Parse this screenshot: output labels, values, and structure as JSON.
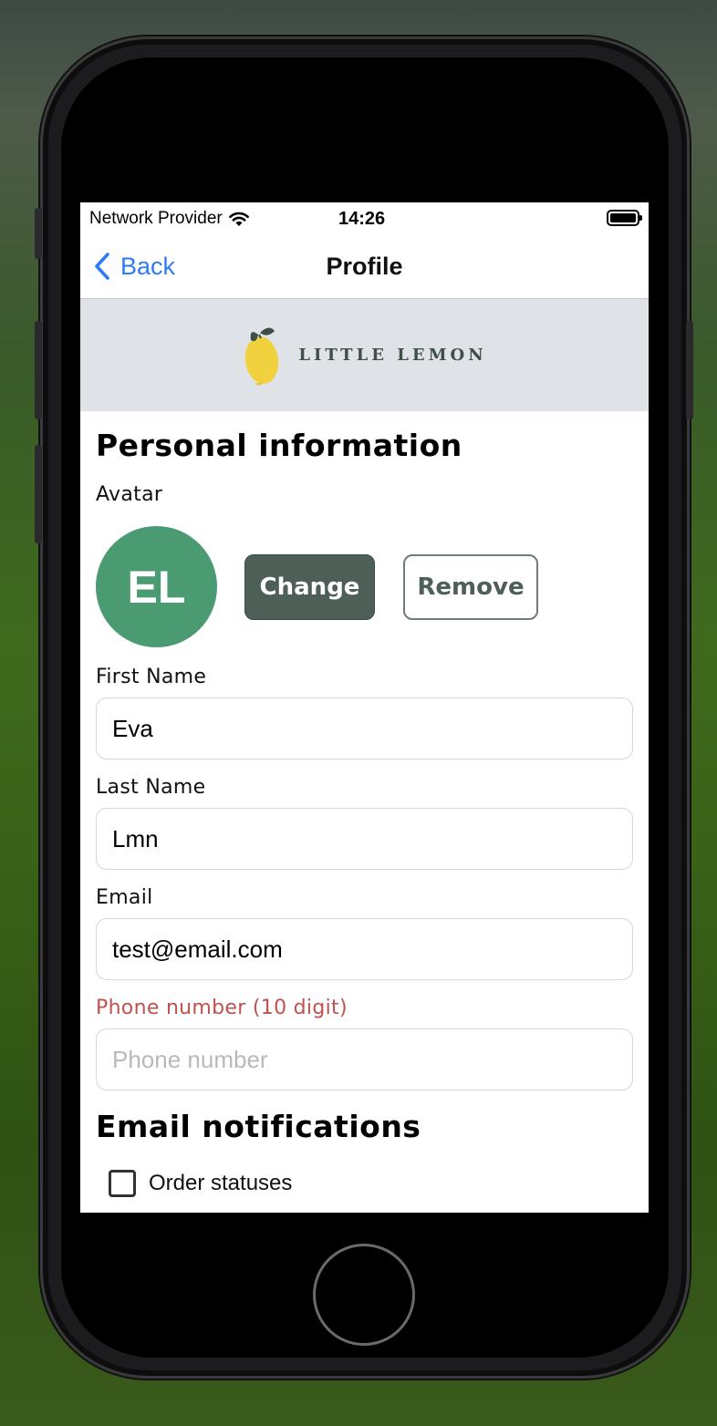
{
  "status_bar": {
    "carrier": "Network Provider",
    "time": "14:26"
  },
  "nav": {
    "back_label": "Back",
    "title": "Profile"
  },
  "brand": {
    "name": "LITTLE LEMON"
  },
  "personal": {
    "title": "Personal information",
    "avatar_label": "Avatar",
    "avatar_initials": "EL",
    "change_label": "Change",
    "remove_label": "Remove"
  },
  "fields": {
    "first_name": {
      "label": "First Name",
      "value": "Eva"
    },
    "last_name": {
      "label": "Last Name",
      "value": "Lmn"
    },
    "email": {
      "label": "Email",
      "value": "test@email.com"
    },
    "phone": {
      "label": "Phone number (10 digit)",
      "value": "",
      "placeholder": "Phone number"
    }
  },
  "notifications": {
    "title": "Email notifications",
    "items": [
      {
        "label": "Order statuses",
        "checked": false
      }
    ]
  },
  "colors": {
    "accent_green": "#4e5f58",
    "avatar_green": "#4a9a72",
    "error_red": "#c0524d",
    "ios_blue": "#2f7bf5",
    "header_gray": "#dfe2e6"
  }
}
